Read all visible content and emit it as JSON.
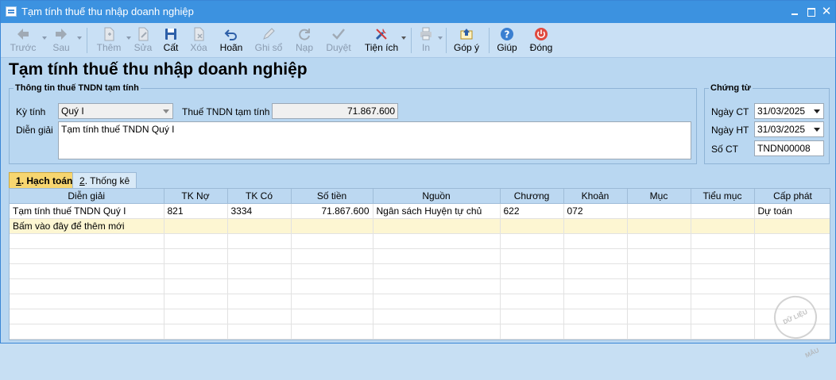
{
  "window": {
    "title": "Tạm tính thuế thu nhập doanh nghiệp",
    "close_glyph": "✕"
  },
  "toolbar": {
    "items": [
      {
        "label": "Trước",
        "icon": "arrow-left-icon",
        "enabled": false
      },
      {
        "label": "Sau",
        "icon": "arrow-right-icon",
        "enabled": false
      },
      {
        "label": "Thêm",
        "icon": "add-document-icon",
        "enabled": false
      },
      {
        "label": "Sửa",
        "icon": "edit-document-icon",
        "enabled": false
      },
      {
        "label": "Cất",
        "icon": "save-icon",
        "enabled": true
      },
      {
        "label": "Xóa",
        "icon": "delete-document-icon",
        "enabled": false
      },
      {
        "label": "Hoãn",
        "icon": "undo-icon",
        "enabled": true
      },
      {
        "label": "Ghi sổ",
        "icon": "pencil-icon",
        "enabled": false
      },
      {
        "label": "Nạp",
        "icon": "refresh-icon",
        "enabled": false
      },
      {
        "label": "Duyệt",
        "icon": "checkmark-icon",
        "enabled": false
      },
      {
        "label": "Tiện ích",
        "icon": "tools-icon",
        "enabled": true
      },
      {
        "label": "In",
        "icon": "printer-icon",
        "enabled": false
      },
      {
        "label": "Góp ý",
        "icon": "feedback-icon",
        "enabled": true
      },
      {
        "label": "Giúp",
        "icon": "help-icon",
        "enabled": true
      },
      {
        "label": "Đóng",
        "icon": "power-icon",
        "enabled": true
      }
    ]
  },
  "page": {
    "title": "Tạm tính thuế thu nhập doanh nghiệp"
  },
  "info": {
    "legend": "Thông tin thuế TNDN tạm tính",
    "period_label": "Kỳ tính",
    "period_value": "Quý I",
    "tax_label": "Thuế TNDN tạm tính",
    "tax_value": "71.867.600",
    "desc_label": "Diễn giải",
    "desc_value": "Tạm tính thuế TNDN Quý I"
  },
  "voucher": {
    "legend": "Chứng từ",
    "date_ct_label": "Ngày CT",
    "date_ct_value": "31/03/2025",
    "date_ht_label": "Ngày HT",
    "date_ht_value": "31/03/2025",
    "number_label": "Số CT",
    "number_value": "TNDN00008"
  },
  "tabs": [
    {
      "key": "1",
      "label": ". Hạch toán",
      "active": true
    },
    {
      "key": "2",
      "label": ". Thống kê",
      "active": false
    }
  ],
  "grid": {
    "columns": [
      "Diễn giải",
      "TK Nợ",
      "TK Có",
      "Số tiền",
      "Nguồn",
      "Chương",
      "Khoản",
      "Mục",
      "Tiểu mục",
      "Cấp phát"
    ],
    "rows": [
      [
        "Tạm tính thuế TNDN Quý I",
        "821",
        "3334",
        "71.867.600",
        "Ngân sách Huyện tự chủ",
        "622",
        "072",
        "",
        "",
        "Dự toán"
      ]
    ],
    "add_row_text": "Bấm vào đây để thêm mới"
  },
  "watermark": {
    "text": "DỮ LIỆU MẪU"
  },
  "colors": {
    "titlebar": "#3c92e0",
    "active_tab": "#f7d670",
    "add_row": "#fdf6d2",
    "window_bg": "#b9d7f1"
  }
}
